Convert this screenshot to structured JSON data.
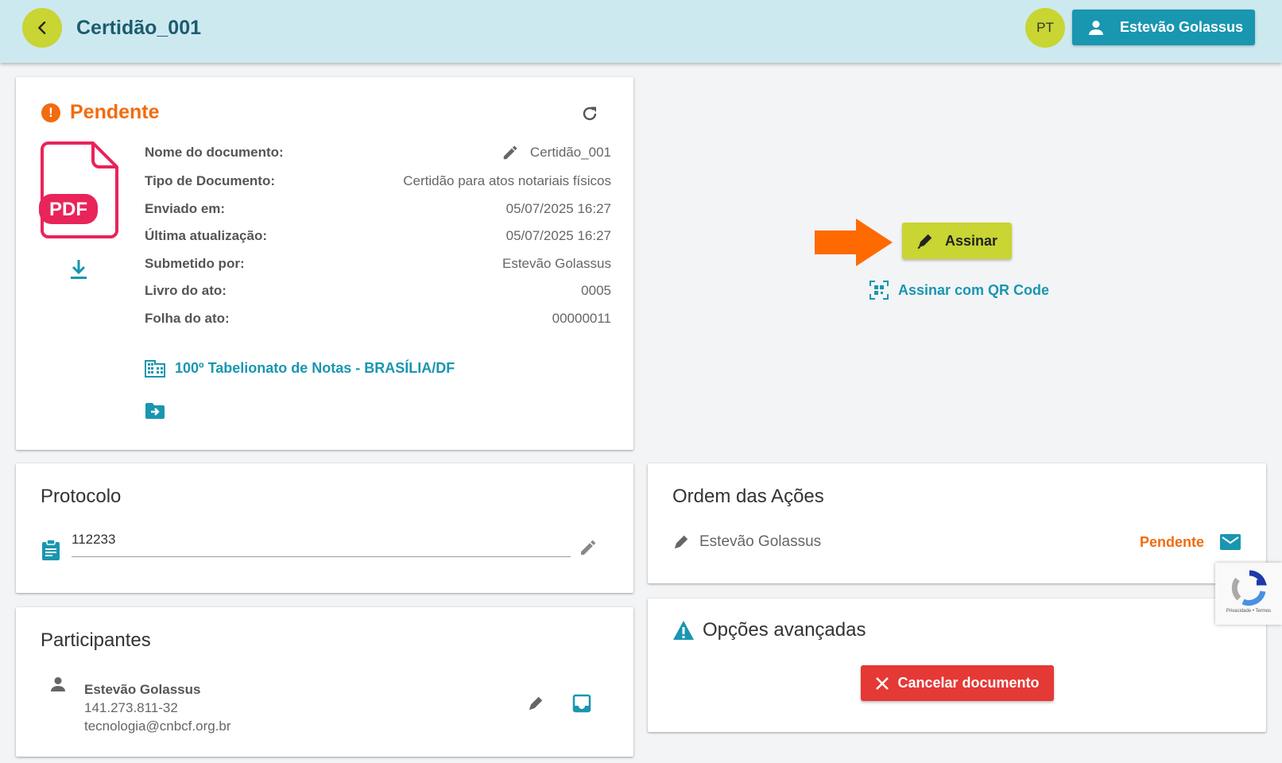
{
  "header": {
    "title": "Certidão_001",
    "lang_label": "PT",
    "user_name": "Estevão Golassus"
  },
  "document": {
    "status": "Pendente",
    "pdf_label": "PDF",
    "fields": [
      {
        "label": "Nome do documento:",
        "value": "Certidão_001"
      },
      {
        "label": "Tipo de Documento:",
        "value": "Certidão para atos notariais físicos"
      },
      {
        "label": "Enviado em:",
        "value": "05/07/2025 16:27"
      },
      {
        "label": "Última atualização:",
        "value": "05/07/2025 16:27"
      },
      {
        "label": "Submetido por:",
        "value": "Estevão Golassus"
      },
      {
        "label": "Livro do ato:",
        "value": "0005"
      },
      {
        "label": "Folha do ato:",
        "value": "00000011"
      }
    ],
    "office": "100º Tabelionato de Notas - BRASÍLIA/DF"
  },
  "actions": {
    "sign_label": "Assinar",
    "sign_qr_label": "Assinar com QR Code"
  },
  "protocolo": {
    "title": "Protocolo",
    "value": "112233"
  },
  "participantes": {
    "title": "Participantes",
    "items": [
      {
        "name": "Estevão Golassus",
        "cpf": "141.273.811-32",
        "email": "tecnologia@cnbcf.org.br"
      }
    ]
  },
  "ordem": {
    "title": "Ordem das Ações",
    "items": [
      {
        "name": "Estevão Golassus",
        "status": "Pendente"
      }
    ]
  },
  "opcoes": {
    "title": "Opções avançadas",
    "cancel_label": "Cancelar documento"
  },
  "recaptcha": {
    "text": "Privacidade • Termos"
  },
  "colors": {
    "header_bg": "#cde9f0",
    "accent_lime": "#c8d532",
    "accent_teal": "#1996b0",
    "pending_orange": "#f26b0f",
    "danger_red": "#e53935",
    "pdf_red": "#e8245a"
  }
}
